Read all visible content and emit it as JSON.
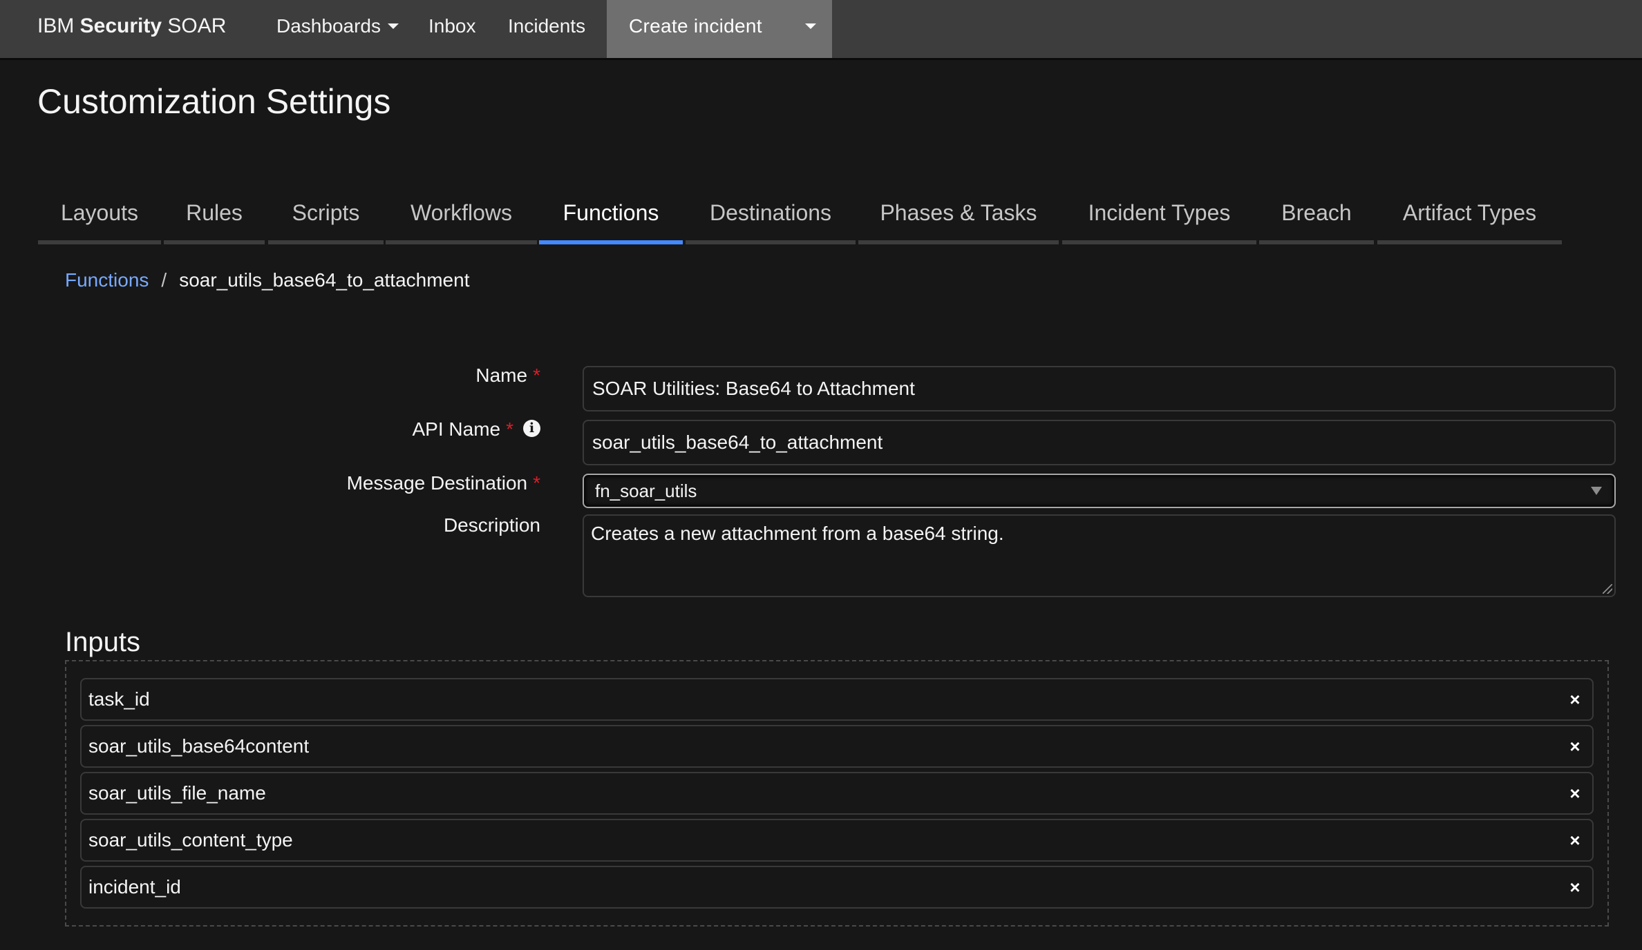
{
  "nav": {
    "brand_prefix": "IBM ",
    "brand_bold": "Security",
    "brand_suffix": " SOAR",
    "items": [
      {
        "label": "Dashboards",
        "has_dropdown": true
      },
      {
        "label": "Inbox"
      },
      {
        "label": "Incidents"
      }
    ],
    "create_incident_label": "Create incident"
  },
  "page": {
    "title": "Customization Settings"
  },
  "tabs": [
    {
      "label": "Layouts",
      "active": false
    },
    {
      "label": "Rules",
      "active": false
    },
    {
      "label": "Scripts",
      "active": false
    },
    {
      "label": "Workflows",
      "active": false
    },
    {
      "label": "Functions",
      "active": true
    },
    {
      "label": "Destinations",
      "active": false
    },
    {
      "label": "Phases & Tasks",
      "active": false
    },
    {
      "label": "Incident Types",
      "active": false
    },
    {
      "label": "Breach",
      "active": false
    },
    {
      "label": "Artifact Types",
      "active": false
    }
  ],
  "breadcrumb": {
    "parent": "Functions",
    "separator": "/",
    "current": "soar_utils_base64_to_attachment"
  },
  "form": {
    "name": {
      "label": "Name",
      "required_mark": "*",
      "value": "SOAR Utilities: Base64 to Attachment"
    },
    "api_name": {
      "label": "API Name",
      "required_mark": "*",
      "info_icon": "i",
      "value": "soar_utils_base64_to_attachment"
    },
    "message_destination": {
      "label": "Message Destination",
      "required_mark": "*",
      "selected": "fn_soar_utils"
    },
    "description": {
      "label": "Description",
      "value": "Creates a new attachment from a base64 string."
    }
  },
  "inputs": {
    "heading": "Inputs",
    "remove_glyph": "×",
    "items": [
      {
        "name": "task_id"
      },
      {
        "name": "soar_utils_base64content"
      },
      {
        "name": "soar_utils_file_name"
      },
      {
        "name": "soar_utils_content_type"
      },
      {
        "name": "incident_id"
      }
    ]
  },
  "colors": {
    "nav_bg": "#3d3d3d",
    "create_bg": "#6f6f6f",
    "page_bg": "#171717",
    "active_tab": "#4589ff",
    "link": "#78a9ff",
    "required": "#da1e28"
  }
}
